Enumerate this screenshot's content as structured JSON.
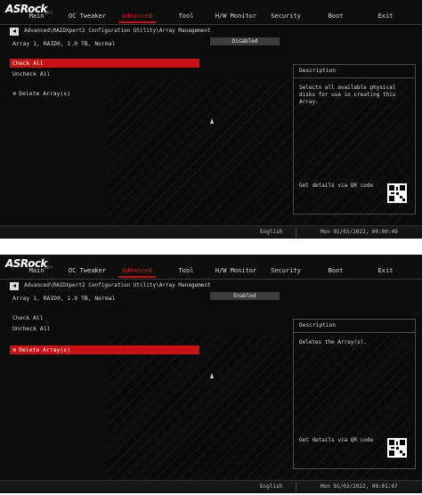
{
  "brand": {
    "logo": "ASRock",
    "sub": "UEFI"
  },
  "tabs": [
    "Main",
    "OC Tweaker",
    "Advanced",
    "Tool",
    "H/W Monitor",
    "Security",
    "Boot",
    "Exit"
  ],
  "active_tab": "Advanced",
  "accent_color": "#c81212",
  "screens": [
    {
      "breadcrumb": "Advanced\\RAIDXpert2 Configuration Utility\\Array Management",
      "array_label": "Array 1, RAID0, 1.0 TB, Normal",
      "array_value": "Disabled",
      "items": [
        "Check All",
        "Uncheck All",
        "Delete Array(s)"
      ],
      "selected_index": 0,
      "description_title": "Description",
      "description_text": "Selects all available physical disks for use in creating this Array.",
      "qr_text": "Get details via QR code",
      "language": "English",
      "datetime": "Mon 01/03/2022, 00:00:49"
    },
    {
      "breadcrumb": "Advanced\\RAIDXpert2 Configuration Utility\\Array Management",
      "array_label": "Array 1, RAID0, 1.0 TB, Normal",
      "array_value": "Enabled",
      "items": [
        "Check All",
        "Uncheck All",
        "Delete Array(s)"
      ],
      "selected_index": 2,
      "description_title": "Description",
      "description_text": "Deletes the Array(s).",
      "qr_text": "Get details via QR code",
      "language": "English",
      "datetime": "Mon 01/03/2022, 00:01:07"
    }
  ],
  "icons": {
    "back": "back-arrow-icon",
    "tool": "wrench-icon",
    "qr": "qr-code-icon"
  }
}
